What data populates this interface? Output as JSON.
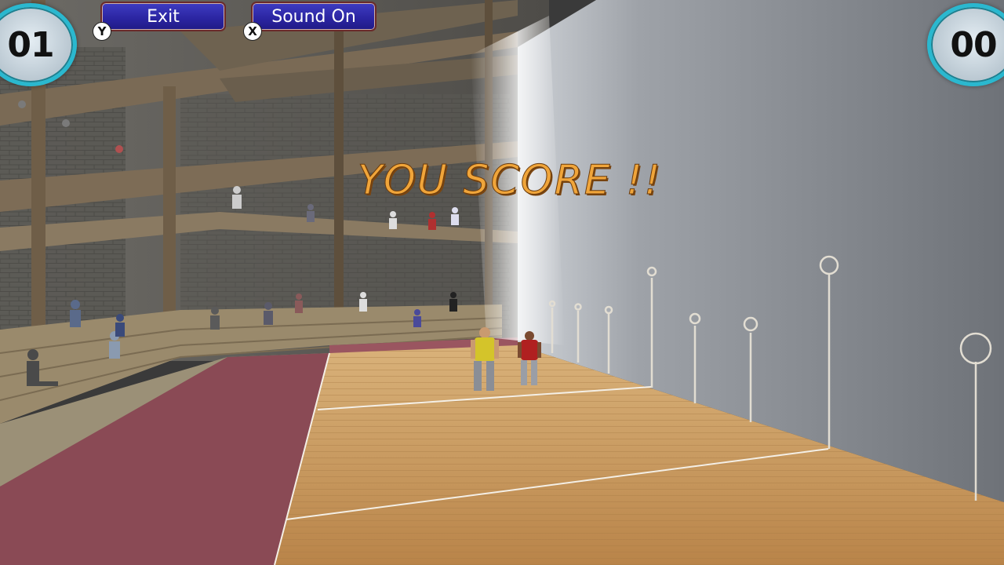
{
  "hud": {
    "left_score": "01",
    "right_score": "00",
    "exit_label": "Exit",
    "exit_key": "Y",
    "sound_label": "Sound On",
    "sound_key": "X"
  },
  "banner": {
    "text": "YOU SCORE !!",
    "color": "#f0a53a"
  },
  "scene": {
    "court_floor_color": "#c8955a",
    "wall_color": "#8e9298",
    "carpet_color": "#8a4a55",
    "player_colors": [
      "#d4c42a",
      "#b02020"
    ]
  }
}
